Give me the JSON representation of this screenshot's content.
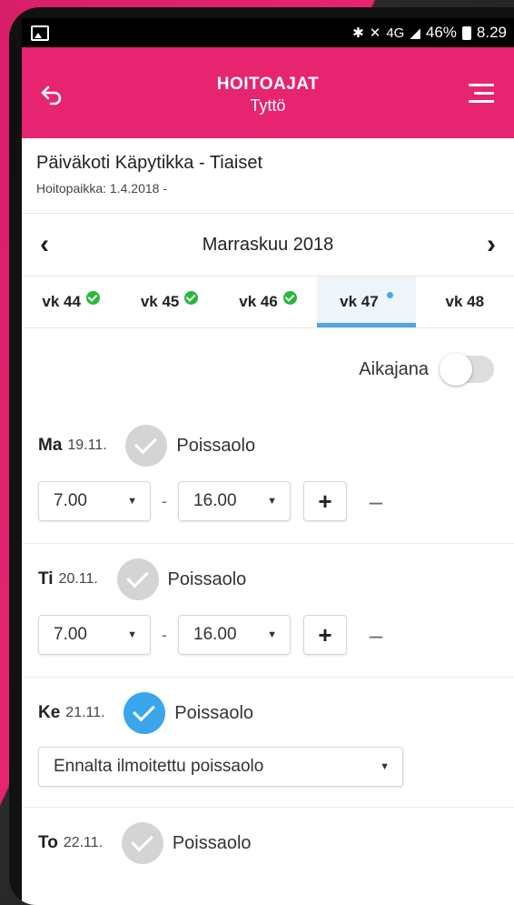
{
  "status": {
    "signal_text": "4G",
    "battery": "46%",
    "time": "8.29"
  },
  "header": {
    "title": "HOITOAJAT",
    "subtitle": "Tyttö"
  },
  "place": {
    "name": "Päiväkoti Käpytikka - Tiaiset",
    "sub": "Hoitopaikka: 1.4.2018 -"
  },
  "month": {
    "label": "Marraskuu 2018"
  },
  "weeks": [
    {
      "label": "vk 44",
      "status": "ok"
    },
    {
      "label": "vk 45",
      "status": "ok"
    },
    {
      "label": "vk 46",
      "status": "ok"
    },
    {
      "label": "vk 47",
      "status": "dot"
    },
    {
      "label": "vk 48",
      "status": ""
    }
  ],
  "timeline": {
    "label": "Aikajana",
    "on": false
  },
  "days": [
    {
      "abbr": "Ma",
      "date": "19.11.",
      "absence_label": "Poissaolo",
      "absent": false,
      "start": "7.00",
      "dash": "-",
      "end": "16.00",
      "plus": "+",
      "minus": "–"
    },
    {
      "abbr": "Ti",
      "date": "20.11.",
      "absence_label": "Poissaolo",
      "absent": false,
      "start": "7.00",
      "dash": "-",
      "end": "16.00",
      "plus": "+",
      "minus": "–"
    },
    {
      "abbr": "Ke",
      "date": "21.11.",
      "absence_label": "Poissaolo",
      "absent": true,
      "reason": "Ennalta ilmoitettu poissaolo"
    },
    {
      "abbr": "To",
      "date": "22.11.",
      "absence_label": "Poissaolo",
      "absent": false
    }
  ],
  "colors": {
    "brand": "#e6246f",
    "accent": "#3aa6ec",
    "ok": "#27b93b"
  }
}
